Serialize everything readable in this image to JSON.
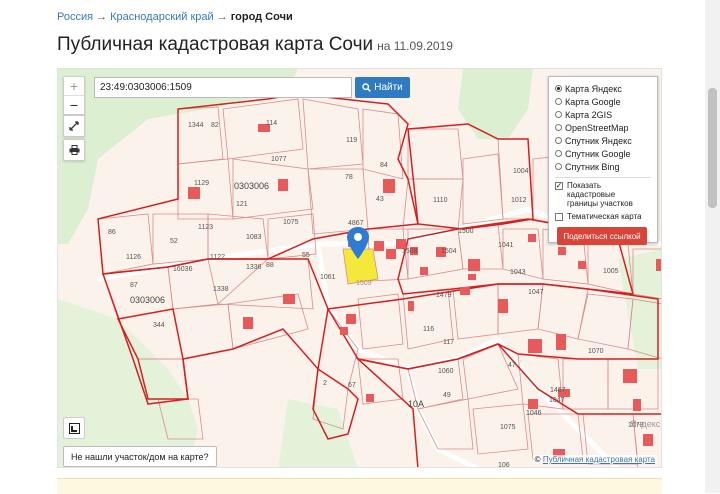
{
  "breadcrumb": {
    "items": [
      "Россия",
      "Краснодарский край"
    ],
    "sep": "→",
    "current": "город Сочи"
  },
  "title": {
    "main": "Публичная кадастровая карта Сочи",
    "date": "на 11.09.2019"
  },
  "map": {
    "zoom_in": "+",
    "zoom_out": "−",
    "search_value": "23:49:0303006:1509",
    "find_label": "Найти",
    "layers": {
      "options": [
        "Карта Яндекс",
        "Карта Google",
        "Карта 2GIS",
        "OpenStreetMap",
        "Спутник Яндекс",
        "Спутник Google",
        "Спутник Bing"
      ],
      "selected_index": 0,
      "checkbox_borders_line1": "Показать кадастровые",
      "checkbox_borders_line2": "границы участков",
      "checkbox_borders_checked": true,
      "checkbox_thematic": "Тематическая карта",
      "checkbox_thematic_checked": false,
      "share_label": "Поделиться ссылкой"
    },
    "not_found_label": "Не нашли участок/дом на карте?",
    "attribution_prefix": "©",
    "attribution_link": "Публичная кадастровая карта",
    "yandex_logo": "Яндекс",
    "parcel_labels": [
      "1344",
      "82",
      "114",
      "119",
      "1077",
      "1129",
      "0303006",
      "121",
      "1083",
      "1075",
      "78",
      "84",
      "1123",
      "86",
      "52",
      "1126",
      "1122",
      "16036",
      "1336",
      "88",
      "87",
      "0303006",
      "344",
      "55",
      "43",
      "1110",
      "1004",
      "1012",
      "4867",
      "1509",
      "1041",
      "1043",
      "1005",
      "1047",
      "1061",
      "1479",
      "116",
      "117",
      "1060",
      "1070",
      "47",
      "1467",
      "1047",
      "1046",
      "1075",
      "1073",
      "10A",
      "49",
      "106",
      "1508",
      "1504",
      "1500",
      "67",
      "2",
      "1338"
    ],
    "colors": {
      "parcel_stroke": "#d68d8d",
      "quarter_border": "#d42020",
      "building": "#e85a5a",
      "selected": "#f4e93a",
      "green": "#dcefd0",
      "pin": "#2d7bd4"
    }
  }
}
